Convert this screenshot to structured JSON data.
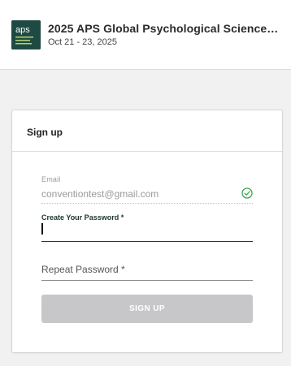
{
  "header": {
    "logo_text": "aps",
    "title": "2025 APS Global Psychological Science…",
    "dates": "Oct 21 - 23, 2025"
  },
  "signup_card": {
    "title": "Sign up",
    "email": {
      "label": "Email",
      "value": "conventiontest@gmail.com",
      "valid_icon": "check-circle-icon"
    },
    "password": {
      "label": "Create Your Password *",
      "value": ""
    },
    "repeat_password": {
      "placeholder": "Repeat Password *",
      "value": ""
    },
    "submit_label": "SIGN UP"
  },
  "colors": {
    "logo_bg": "#1f4a43",
    "valid_green": "#3aa655",
    "active_underline": "#1e3530",
    "disabled_button": "#c7c7c9"
  }
}
